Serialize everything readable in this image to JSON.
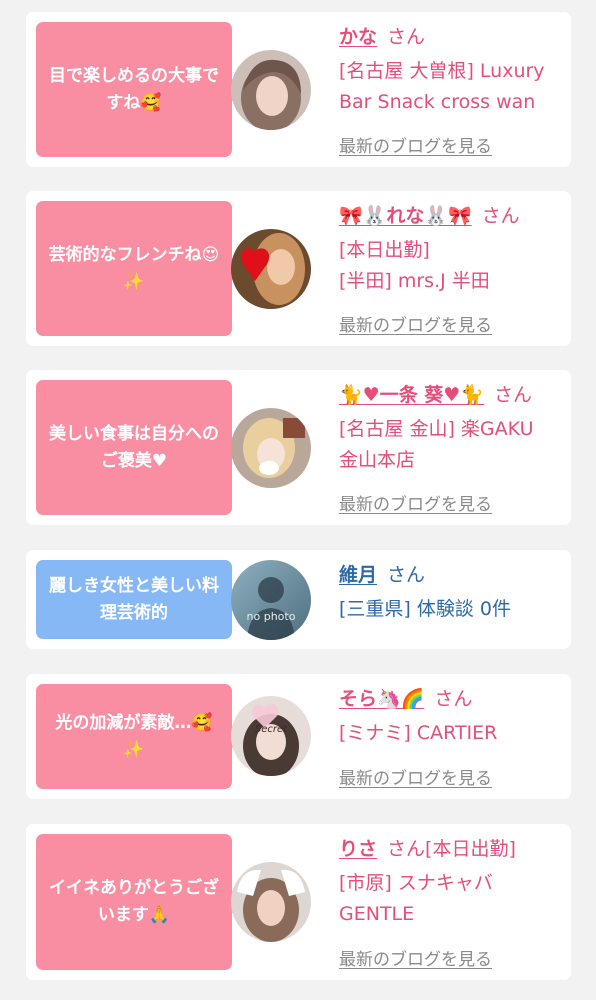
{
  "blog_link_label": "最新のブログを見る",
  "san_label": "さん",
  "cards": [
    {
      "comment": "目で楽しめるの大事ですね🥰",
      "name": "かな",
      "san_suffix": "",
      "details": [
        "[名古屋 大曽根] Luxury",
        "Bar Snack cross wan"
      ],
      "has_blog": true,
      "theme": "pink"
    },
    {
      "comment": "芸術的なフレンチね😍✨",
      "name": "🎀🐰れな🐰🎀",
      "san_suffix": "",
      "details": [
        "[本日出勤]",
        "[半田] mrs.J 半田"
      ],
      "has_blog": true,
      "theme": "pink"
    },
    {
      "comment": "美しい食事は自分へのご褒美♥",
      "name": "🐈♥一条 葵♥🐈",
      "san_suffix": "",
      "details": [
        "[名古屋 金山] 楽GAKU",
        "金山本店"
      ],
      "has_blog": true,
      "theme": "pink"
    },
    {
      "comment": "麗しき女性と美しい料理芸術的",
      "name": "維月",
      "san_suffix": "",
      "details": [
        "[三重県] 体験談 0件"
      ],
      "has_blog": false,
      "theme": "blue",
      "avatar_text": "no photo"
    },
    {
      "comment": "光の加減が素敵…🥰✨",
      "name": "そら🦄🌈",
      "san_suffix": "",
      "details": [
        "[ミナミ] CARTIER"
      ],
      "has_blog": true,
      "theme": "pink",
      "avatar_text": "Secret"
    },
    {
      "comment": "イイネありがとうございます🙏",
      "name": "りさ",
      "san_suffix": "[本日出勤]",
      "details": [
        "[市原] スナキャバ",
        "GENTLE"
      ],
      "has_blog": true,
      "theme": "pink"
    }
  ]
}
